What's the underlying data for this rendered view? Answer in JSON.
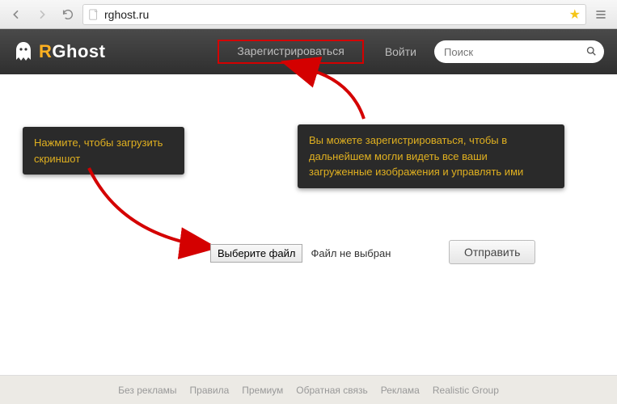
{
  "browser": {
    "url_display": "rghost.ru"
  },
  "header": {
    "logo_r": "R",
    "logo_rest": "Ghost",
    "register_label": "Зарегистрироваться",
    "login_label": "Войти",
    "search_placeholder": "Поиск"
  },
  "annotations": {
    "upload_tip": "Нажмите, чтобы загрузить скриншот",
    "register_tip": "Вы можете зарегистрироваться, чтобы в дальнейшем могли видеть все ваши загруженные изображения и управлять ими"
  },
  "main": {
    "choose_file_label": "Выберите файл",
    "no_file_label": "Файл не выбран",
    "submit_label": "Отправить"
  },
  "footer": {
    "links": [
      "Без рекламы",
      "Правила",
      "Премиум",
      "Обратная связь",
      "Реклама",
      "Realistic Group"
    ]
  }
}
